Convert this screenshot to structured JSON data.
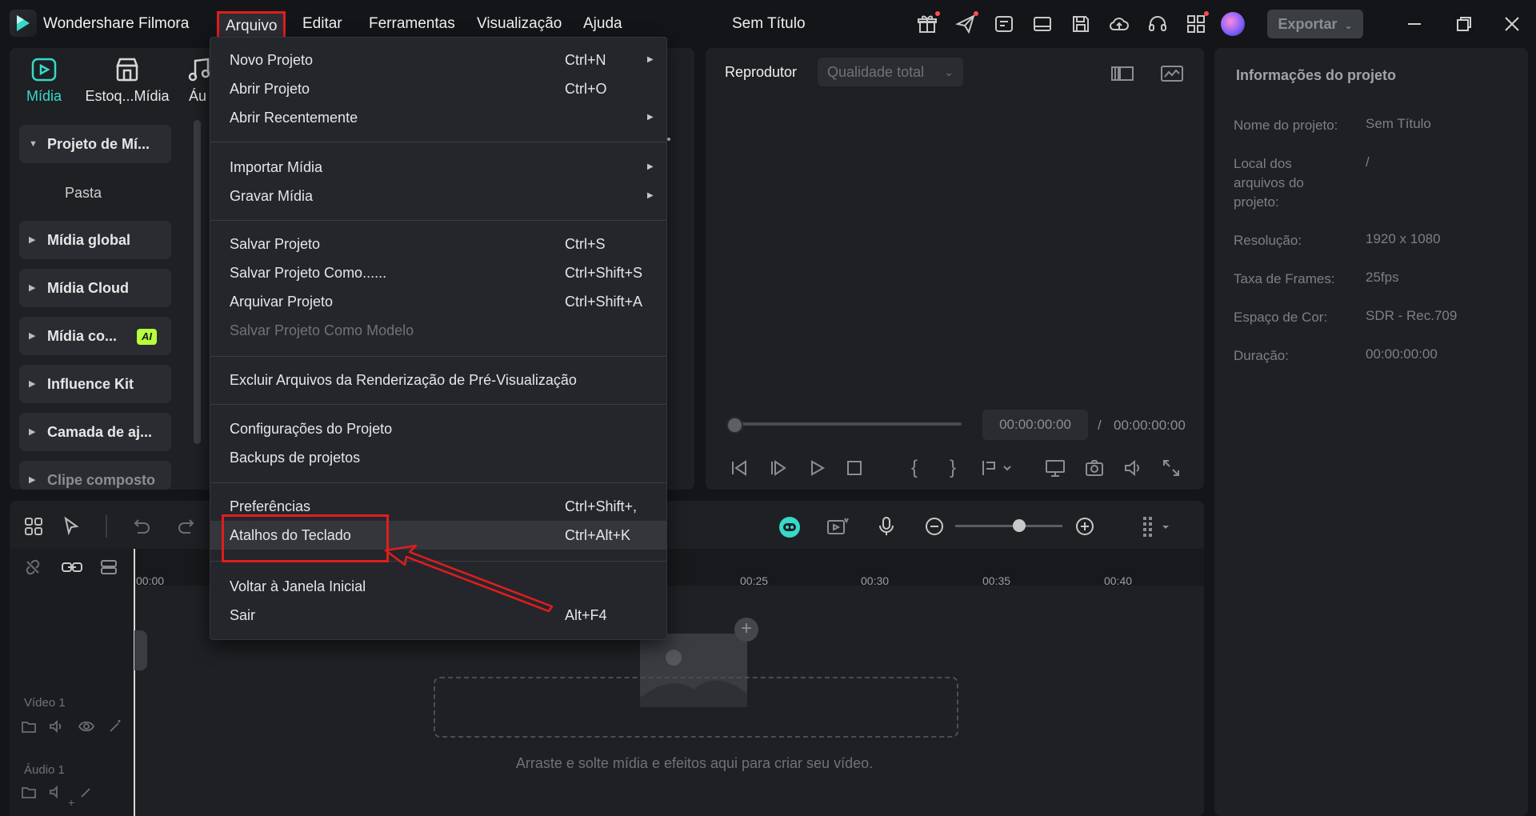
{
  "app": {
    "name": "Wondershare Filmora",
    "document_title": "Sem Título",
    "menu_bar": [
      "Arquivo",
      "Editar",
      "Ferramentas",
      "Visualização",
      "Ajuda"
    ],
    "export_label": "Exportar"
  },
  "media_tabs": [
    {
      "label": "Mídia",
      "icon": "media-icon",
      "active": true
    },
    {
      "label": "Estoq...Mídia",
      "icon": "stock-media-icon"
    },
    {
      "label": "Áu",
      "icon": "audio-icon"
    }
  ],
  "sidebar": {
    "items": [
      {
        "label": "Projeto de Mí..."
      },
      {
        "label": "Pasta"
      },
      {
        "label": "Mídia global"
      },
      {
        "label": "Mídia Cloud"
      },
      {
        "label": "Mídia co...",
        "badge": "AI"
      },
      {
        "label": "Influence Kit"
      },
      {
        "label": "Camada de aj..."
      },
      {
        "label": "Clipe composto"
      }
    ]
  },
  "player": {
    "label": "Reprodutor",
    "quality": "Qualidade total",
    "time_current": "00:00:00:00",
    "time_separator": "/",
    "time_total": "00:00:00:00"
  },
  "project_info": {
    "title": "Informações do projeto",
    "rows": [
      {
        "label": "Nome do projeto:",
        "value": "Sem Título"
      },
      {
        "label": "Local dos arquivos do projeto:",
        "value": "/"
      },
      {
        "label": "Resolução:",
        "value": "1920 x 1080"
      },
      {
        "label": "Taxa de Frames:",
        "value": "25fps"
      },
      {
        "label": "Espaço de Cor:",
        "value": "SDR - Rec.709"
      },
      {
        "label": "Duração:",
        "value": "00:00:00:00"
      }
    ]
  },
  "timeline": {
    "ticks": [
      "00:00",
      "00:25",
      "00:30",
      "00:35",
      "00:40"
    ],
    "tracks": [
      "Vídeo 1",
      "Áudio 1"
    ],
    "drop_hint": "Arraste e solte mídia e efeitos aqui para criar seu vídeo."
  },
  "file_menu": {
    "items": [
      {
        "label": "Novo Projeto",
        "shortcut": "Ctrl+N",
        "submenu": true
      },
      {
        "label": "Abrir Projeto",
        "shortcut": "Ctrl+O"
      },
      {
        "label": "Abrir Recentemente",
        "submenu": true
      },
      {
        "label": "Importar Mídia",
        "submenu": true
      },
      {
        "label": "Gravar Mídia",
        "submenu": true
      },
      {
        "label": "Salvar Projeto",
        "shortcut": "Ctrl+S"
      },
      {
        "label": "Salvar Projeto Como......",
        "shortcut": "Ctrl+Shift+S"
      },
      {
        "label": "Arquivar Projeto",
        "shortcut": "Ctrl+Shift+A"
      },
      {
        "label": "Salvar Projeto Como Modelo",
        "disabled": true
      },
      {
        "label": "Excluir Arquivos da Renderização de Pré-Visualização"
      },
      {
        "label": "Configurações do Projeto"
      },
      {
        "label": "Backups de projetos"
      },
      {
        "label": "Preferências",
        "shortcut": "Ctrl+Shift+,"
      },
      {
        "label": "Atalhos do Teclado",
        "shortcut": "Ctrl+Alt+K",
        "highlighted": true
      },
      {
        "label": "Voltar à Janela Inicial"
      },
      {
        "label": "Sair",
        "shortcut": "Alt+F4"
      }
    ]
  },
  "colors": {
    "accent": "#37d9c8",
    "annotation": "#e11d1d",
    "background": "#141519",
    "panel": "#1e2024"
  }
}
